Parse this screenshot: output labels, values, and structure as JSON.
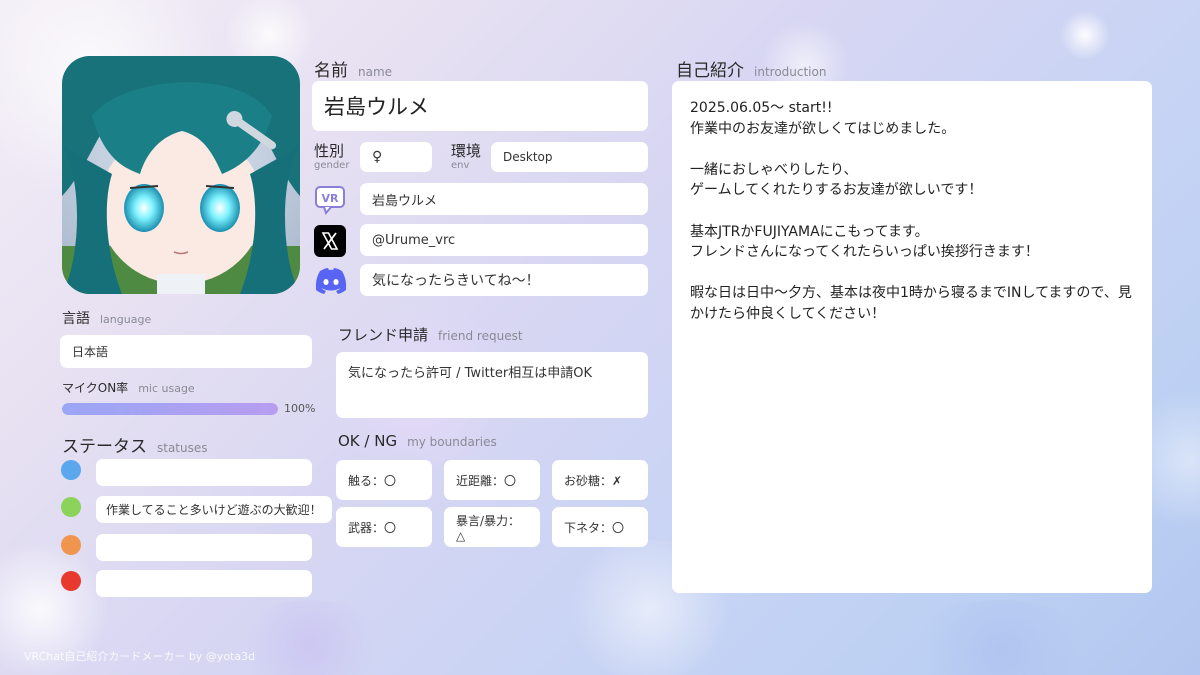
{
  "profile": {
    "name_heading": "名前",
    "name_heading_en": "name",
    "name": "岩島ウルメ",
    "gender_heading": "性別",
    "gender_heading_en": "gender",
    "gender": "♀",
    "env_heading": "環境",
    "env_heading_en": "env",
    "env": "Desktop",
    "vrchat_name": "岩島ウルメ",
    "x_handle": "@Urume_vrc",
    "discord": "気になったらきいてね～！"
  },
  "language": {
    "heading": "言語",
    "heading_en": "language",
    "value": "日本語"
  },
  "mic": {
    "heading": "マイクON率",
    "heading_en": "mic usage",
    "percent_label": "100%",
    "level": 1.0
  },
  "statuses": {
    "heading": "ステータス",
    "heading_en": "statuses",
    "items": [
      {
        "color": "#5aa7ee",
        "text": ""
      },
      {
        "color": "#8bd35a",
        "text": "作業してること多いけど遊ぶの大歓迎！"
      },
      {
        "color": "#f0954e",
        "text": ""
      },
      {
        "color": "#e8392f",
        "text": ""
      }
    ]
  },
  "friend_request": {
    "heading": "フレンド申請",
    "heading_en": "friend request",
    "text": "気になったら許可 / Twitter相互は申請OK"
  },
  "boundaries": {
    "heading": "OK / NG",
    "heading_en": "my boundaries",
    "items": [
      "触る：〇",
      "近距離：〇",
      "お砂糖：✗",
      "武器：〇",
      "暴言/暴力：△",
      "下ネタ：〇"
    ]
  },
  "intro": {
    "heading": "自己紹介",
    "heading_en": "introduction",
    "text": "2025.06.05〜 start!!\n作業中のお友達が欲しくてはじめました。\n\n一緒におしゃべりしたり、\nゲームしてくれたりするお友達が欲しいです！\n\n基本JTRかFUJIYAMAにこもってます。\nフレンドさんになってくれたらいっぱい挨拶行きます！\n\n暇な日は日中〜夕方、基本は夜中1時から寝るまでINしてますので、見かけたら仲良くしてください！"
  },
  "footer": "VRChat自己紹介カードメーカー by @yota3d",
  "colors": {
    "accent_bar_start": "#9aa6f5",
    "accent_bar_end": "#b89df0",
    "discord": "#5865F2",
    "vrchat": "#8a7fd8"
  },
  "icons": [
    "vrchat-icon",
    "x-icon",
    "discord-icon"
  ]
}
